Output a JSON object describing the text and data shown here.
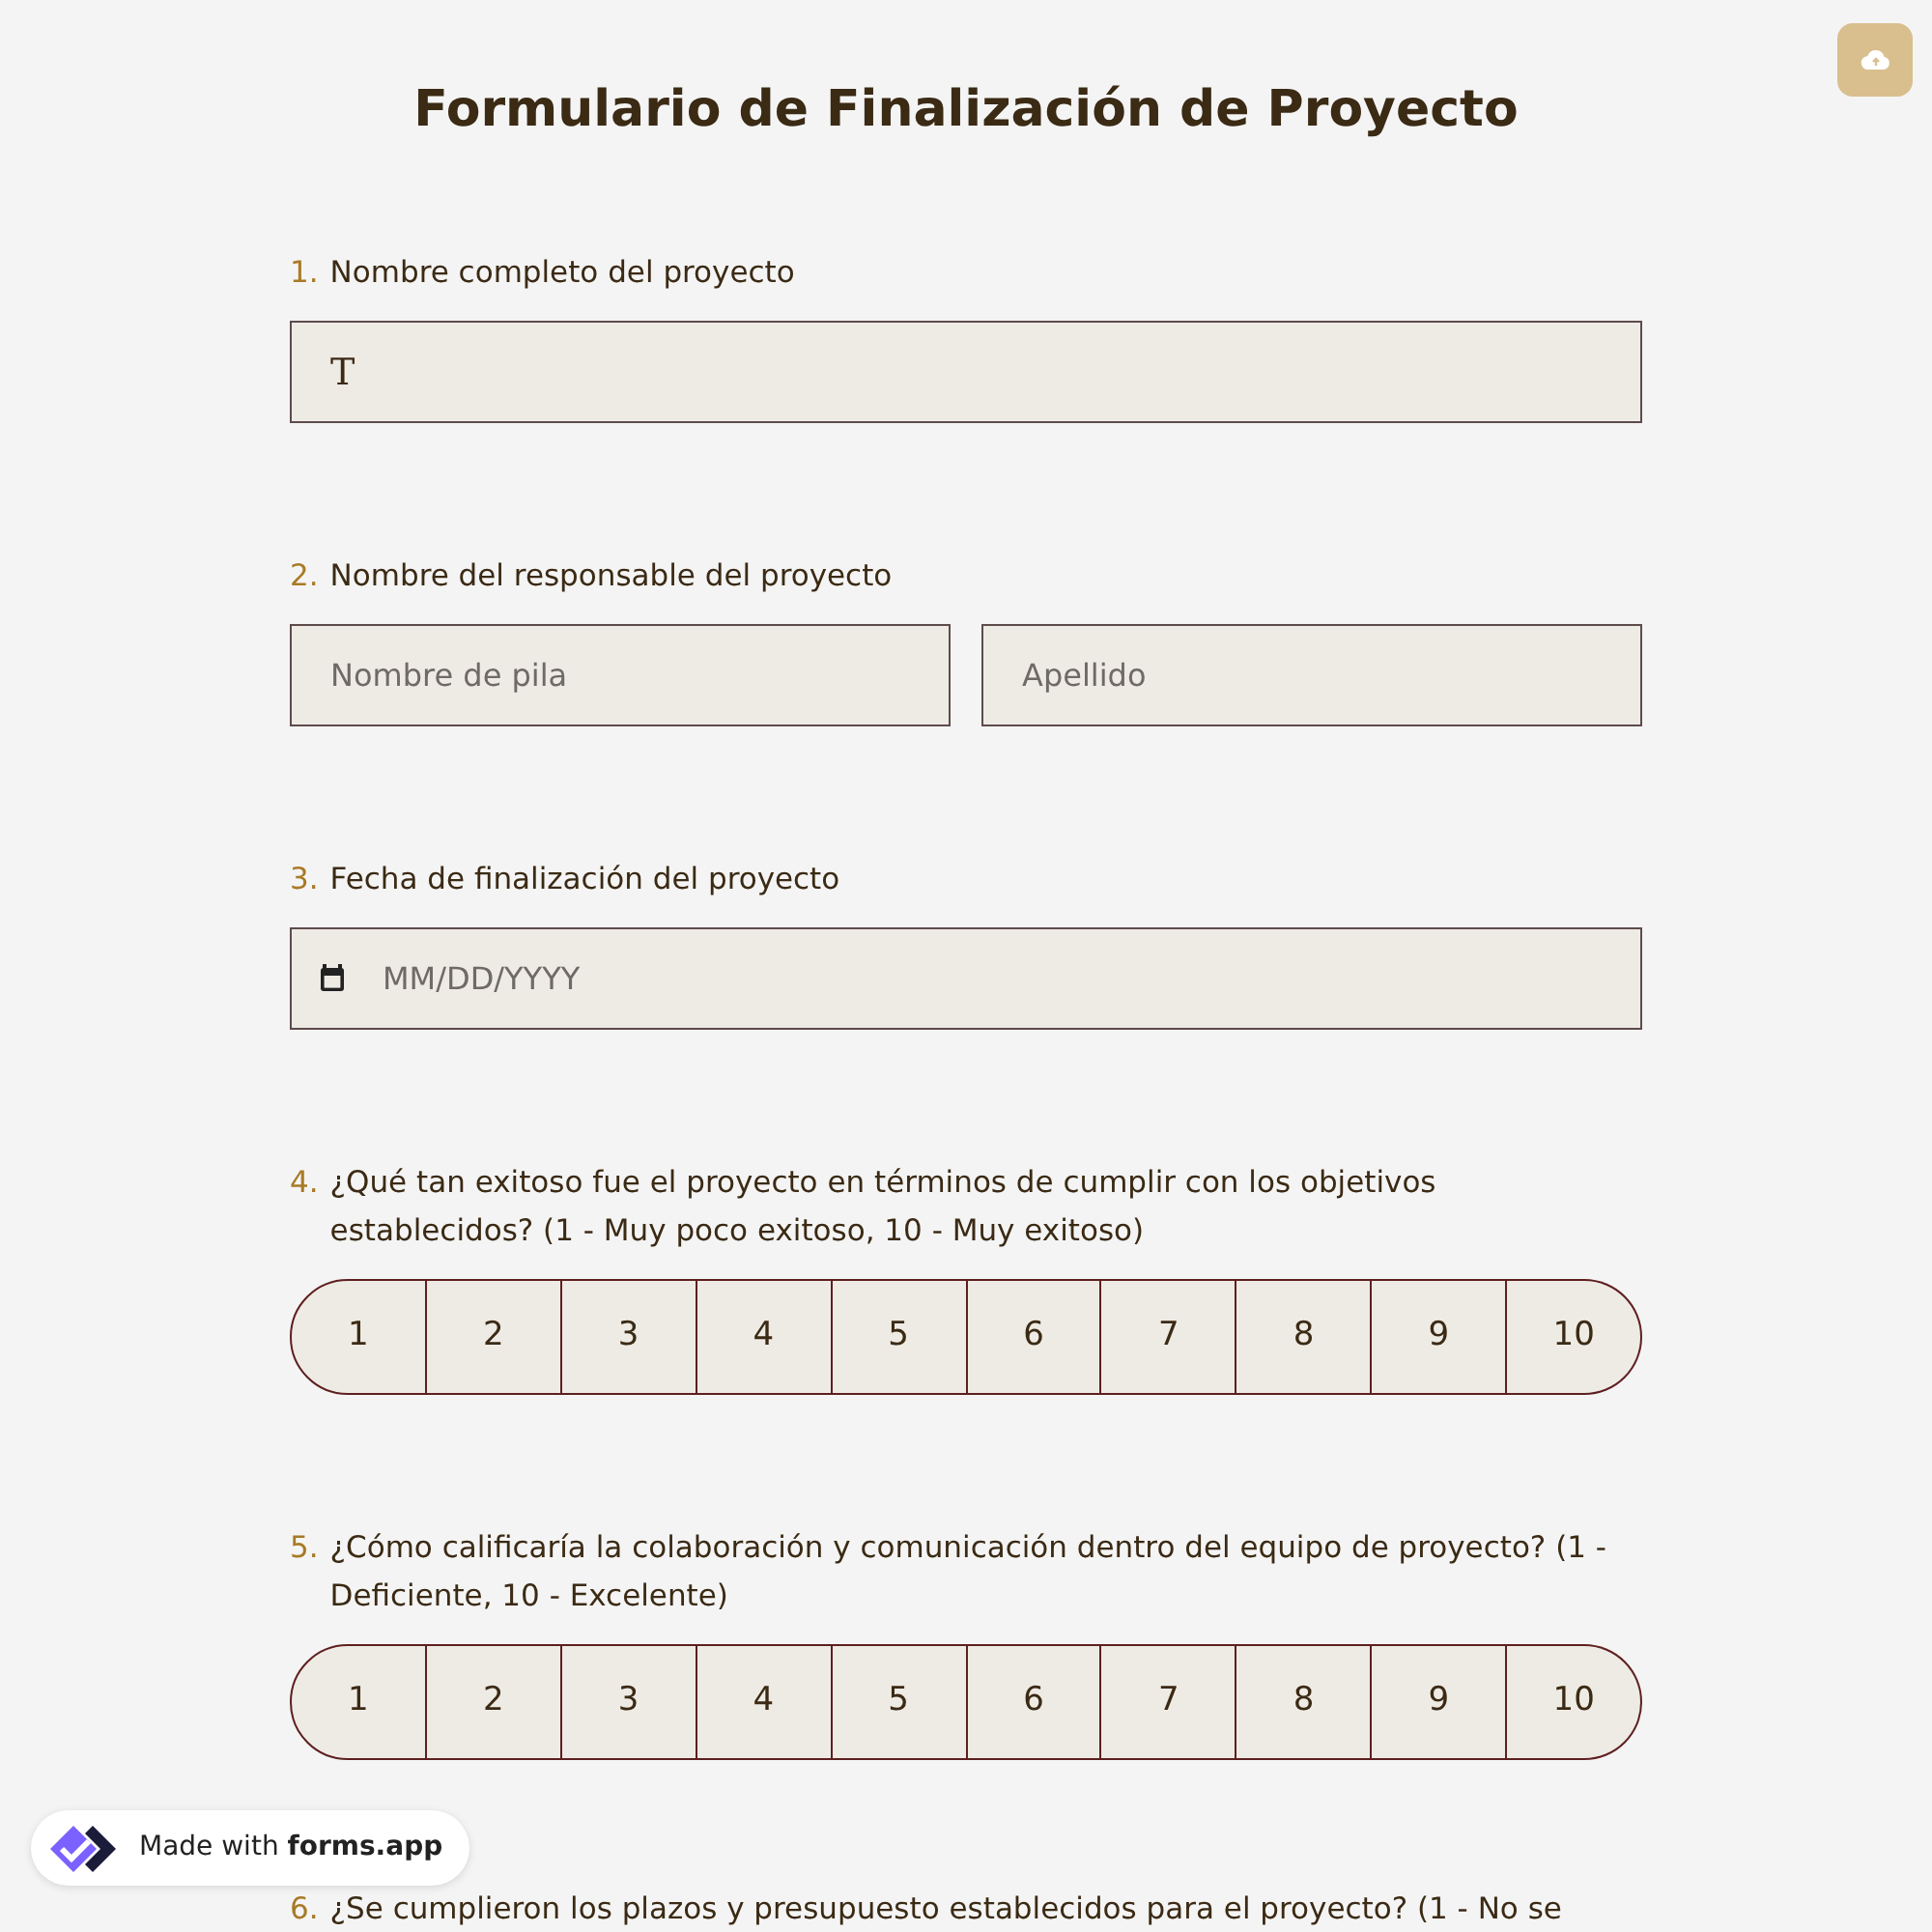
{
  "title": "Formulario de Finalización de Proyecto",
  "questions": [
    {
      "number": "1.",
      "label": "Nombre completo del proyecto",
      "kind": "text",
      "fields": [
        {
          "value": "T"
        }
      ]
    },
    {
      "number": "2.",
      "label": "Nombre del responsable del proyecto",
      "kind": "name",
      "fields": [
        {
          "placeholder": "Nombre de pila"
        },
        {
          "placeholder": "Apellido"
        }
      ]
    },
    {
      "number": "3.",
      "label": "Fecha de finalización del proyecto",
      "kind": "date",
      "fields": [
        {
          "placeholder": "MM/DD/YYYY"
        }
      ]
    },
    {
      "number": "4.",
      "label": "¿Qué tan exitoso fue el proyecto en términos de cumplir con los objetivos establecidos? (1 - Muy poco exitoso, 10 - Muy exitoso)",
      "kind": "rating",
      "options": [
        {
          "label": "1",
          "selected": false
        },
        {
          "label": "2",
          "selected": false
        },
        {
          "label": "3",
          "selected": false
        },
        {
          "label": "4",
          "selected": false
        },
        {
          "label": "5",
          "selected": false
        },
        {
          "label": "6",
          "selected": false
        },
        {
          "label": "7",
          "selected": false
        },
        {
          "label": "8",
          "selected": false
        },
        {
          "label": "9",
          "selected": false
        },
        {
          "label": "10",
          "selected": false
        }
      ]
    },
    {
      "number": "5.",
      "label": "¿Cómo calificaría la colaboración y comunicación dentro del equipo de proyecto? (1 - Deficiente, 10 - Excelente)",
      "kind": "rating",
      "options": [
        {
          "label": "1",
          "selected": false
        },
        {
          "label": "2",
          "selected": false
        },
        {
          "label": "3",
          "selected": false
        },
        {
          "label": "4",
          "selected": false
        },
        {
          "label": "5",
          "selected": false
        },
        {
          "label": "6",
          "selected": false
        },
        {
          "label": "7",
          "selected": false
        },
        {
          "label": "8",
          "selected": false
        },
        {
          "label": "9",
          "selected": false
        },
        {
          "label": "10",
          "selected": false
        }
      ]
    },
    {
      "number": "6.",
      "label": "¿Se cumplieron los plazos y presupuesto establecidos para el proyecto? (1 - No se",
      "kind": "cut"
    }
  ],
  "badge": {
    "prefix": "Made with",
    "brand": "forms.app"
  }
}
